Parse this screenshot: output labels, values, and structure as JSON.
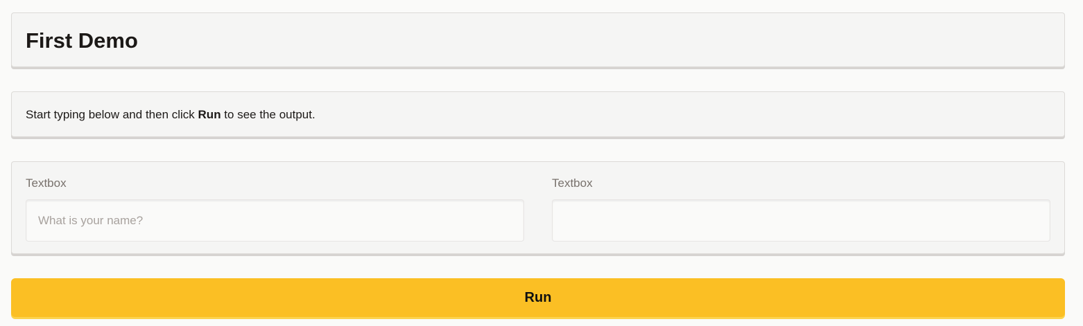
{
  "header": {
    "title": "First Demo"
  },
  "description": {
    "before": "Start typing below and then click ",
    "bold": "Run",
    "after": " to see the output."
  },
  "inputs": {
    "left": {
      "label": "Textbox",
      "value": "",
      "placeholder": "What is your name?"
    },
    "right": {
      "label": "Textbox",
      "value": "",
      "placeholder": ""
    }
  },
  "actions": {
    "run_label": "Run"
  },
  "colors": {
    "accent": "#fbbf24",
    "panel_background": "#f5f5f4",
    "page_background": "#fafaf9",
    "label_text": "#78716c"
  }
}
